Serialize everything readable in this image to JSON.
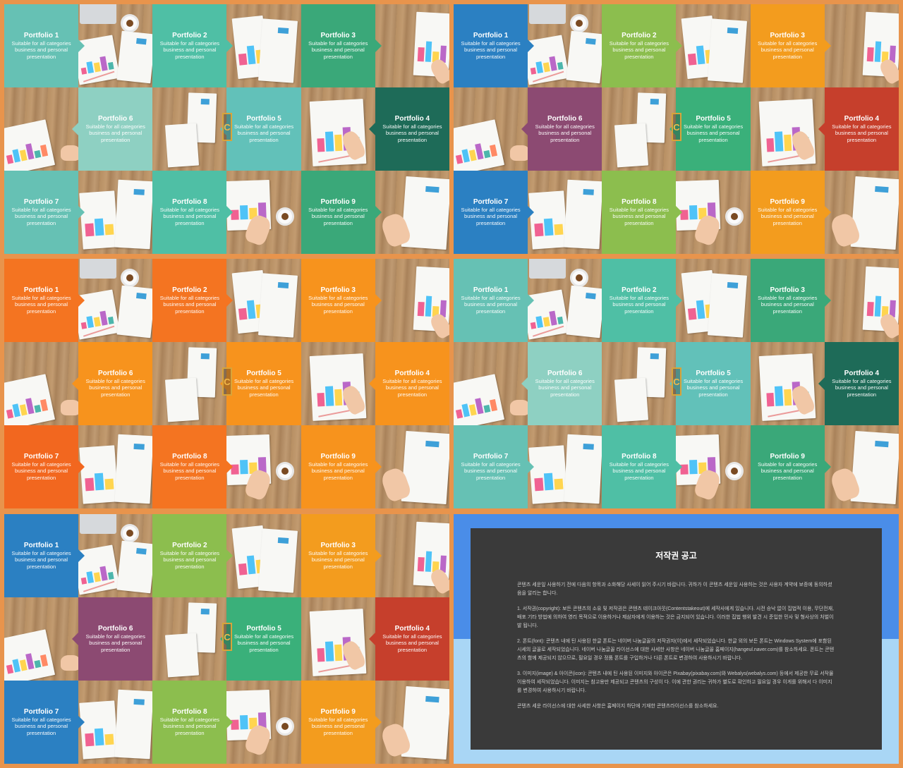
{
  "cards": [
    {
      "title": "Portfolio 1",
      "desc": "Suitable for all categories business and personal presentation"
    },
    {
      "title": "Portfolio 2",
      "desc": "Suitable for all categories business and personal presentation"
    },
    {
      "title": "Portfolio 3",
      "desc": "Suitable for all categories business and personal presentation"
    },
    {
      "title": "Portfolio 4",
      "desc": "Suitable for all categories business and personal presentation"
    },
    {
      "title": "Portfolio 5",
      "desc": "Suitable for all categories business and personal presentation"
    },
    {
      "title": "Portfolio 6",
      "desc": "Suitable for all categories business and personal presentation"
    },
    {
      "title": "Portfolio 7",
      "desc": "Suitable for all categories business and personal presentation"
    },
    {
      "title": "Portfolio 8",
      "desc": "Suitable for all categories business and personal presentation"
    },
    {
      "title": "Portfolio 9",
      "desc": "Suitable for all categories business and personal presentation"
    }
  ],
  "themes": [
    {
      "name": "teal",
      "colors": [
        "#66c1b4",
        "#4fbfa5",
        "#3aa879",
        "#1e6b58",
        "#62c1b9",
        "#8ed0c2",
        "#66c1b4",
        "#4fbfa5",
        "#3aa879"
      ]
    },
    {
      "name": "multicolor",
      "colors": [
        "#2b80c2",
        "#8cbe4e",
        "#f39c1e",
        "#c63f2c",
        "#3ab07a",
        "#8c4a72",
        "#2b80c2",
        "#8cbe4e",
        "#f39c1e"
      ]
    },
    {
      "name": "orange",
      "colors": [
        "#f47421",
        "#f47421",
        "#f7931d",
        "#f7931d",
        "#f7931d",
        "#f7931d",
        "#f2671f",
        "#f47421",
        "#f7931d"
      ]
    },
    {
      "name": "teal-alt",
      "colors": [
        "#66c1b4",
        "#4fbfa5",
        "#3aa879",
        "#1e6b58",
        "#62c1b9",
        "#8ed0c2",
        "#66c1b4",
        "#4fbfa5",
        "#3aa879"
      ]
    },
    {
      "name": "multicolor-alt",
      "colors": [
        "#2b80c2",
        "#8cbe4e",
        "#f39c1e",
        "#c63f2c",
        "#3ab07a",
        "#8c4a72",
        "#2b80c2",
        "#8cbe4e",
        "#f39c1e"
      ]
    }
  ],
  "watermark": {
    "letter": "C"
  },
  "notice": {
    "title": "저작권 공고",
    "p1": "콘텐츠 세운잎 사용하기 전에 다음의 항목과 소화해당 사세이 읽어 주시기 바랍니다. 귀하가 이 콘텐츠 세운잎 사용하는 것은 사용자 계약에 보증에 동의하셨음을 알리는 합니다.",
    "p2": "1. 서작권(copyright): 보든 콘텐츠의 소유 및 저작권은 콘텐츠 테이크아웃(Contentstakeout)에 세작사에게 있습니다. 시전 승낙 없이 집법적 이용, 무단전재, 배포 기타 방법에 의하여 영리 목적으로 이용하거나 제삼자에게 이용하는 것은 금지되어 있습니다. 이러한 집법 행위 발견 시 준입한 민사 및 형사상의 처벌이 발 됩니다.",
    "p3": "2. 폰트(font): 콘텐츠 내에 틴 사용된 한글 폰트는 네이버 나눔글꼴의 저작권자(이)에서 세작되었습니다. 한글 외의 보든 폰트는 Windows System에 포함된 시세의 글꼴로 세작되었습니다. 네이버 나눔글꼴 라이선스에 대한 사세한 사항은 네이버 나눔글꼴 홈페이지(hangeul.naver.com)를 참소하세요. 폰트는 콘텐츠의 함께 제공되지 않으므로, 필요일 경우 정품 폰트를 구입하거나 다른 폰트로 변경하여 사용하시기 바랍니다.",
    "p4": "3. 이미지(image) & 아이콘(icon): 콘텐츠 내에 틴 사용된 이미지와 아이콘은 Pixabay(pixabay.com)와 Webalys(webalys.com) 등에서 제공한 무료 서작물 이용하여 세작되었습니다. 이미지는 참고용만 제공되고 콘텐츠의 구성이 다. 이에 관한 권리는 귀하가 별도로 확인하고 필요일 경우 이게를 위해서 다 이미지를 변경하여 사용하시기 바랍니다.",
    "p5": "콘텐츠 세운 라이선스에 대한 사세한 사항은 홈페이지 하단에 기재한 콘텐츠라이선스를 참소하세요."
  }
}
